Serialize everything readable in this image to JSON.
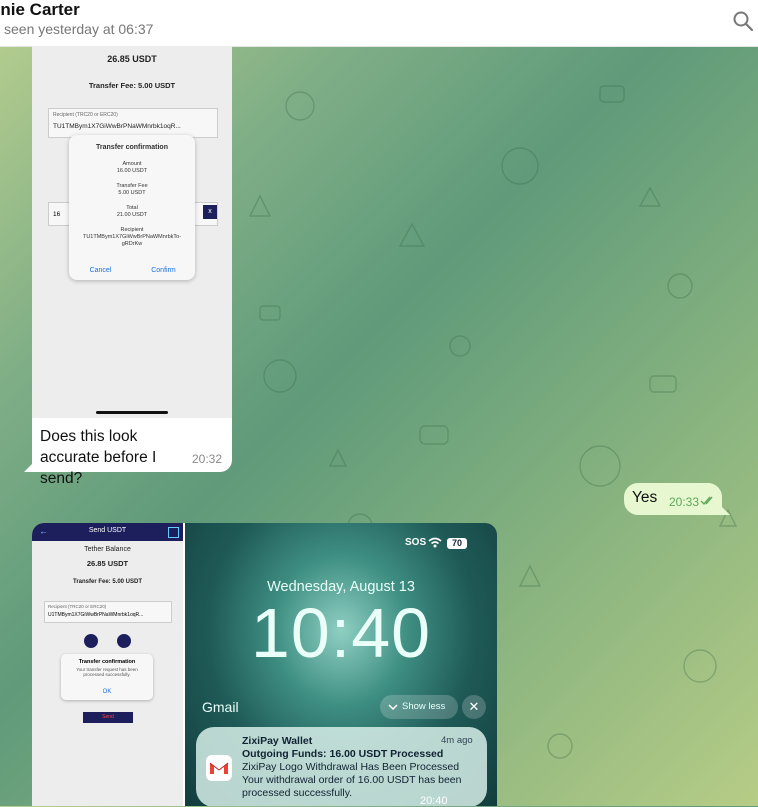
{
  "header": {
    "contact_name": "nnie Carter",
    "status": "seen yesterday at 06:37"
  },
  "message1": {
    "caption": "Does this look accurate before I send?",
    "time": "20:32",
    "screenshot": {
      "balance": "26.85 USDT",
      "transfer_fee": "Transfer Fee: 5.00 USDT",
      "recipient_label": "Recipient (TRC20 or ERC20)",
      "recipient_value": "TU1TMBym1X7GiWwBrPNaWMnrbk1oqR...",
      "amount_value": "16",
      "dialog": {
        "title": "Transfer confirmation",
        "amount_label": "Amount",
        "amount_value": "16.00 USDT",
        "fee_label": "Transfer Fee",
        "fee_value": "5.00 USDT",
        "total_label": "Total",
        "total_value": "21.00 USDT",
        "recipient_label": "Recipient",
        "recipient_value": "TU1TMBym1X7GiWwBrPNaWMnrbkTo-gRDrKw",
        "cancel": "Cancel",
        "confirm": "Confirm"
      }
    }
  },
  "message2": {
    "text": "Yes",
    "time": "20:33"
  },
  "message3": {
    "time": "20:40",
    "wallet_screenshot": {
      "title": "Send USDT",
      "balance_label": "Tether Balance",
      "balance": "26.85 USDT",
      "transfer_fee": "Transfer Fee: 5.00 USDT",
      "recipient_label": "Recipient (TRC20 or ERC20)",
      "recipient_value": "U1TMBym1X7GiWwBrPNaWMnrbk1oqR...",
      "dialog_title": "Transfer confirmation",
      "dialog_text": "Your transfer request has been processed successfully.",
      "dialog_ok": "OK",
      "send_button": "Send"
    },
    "lockscreen": {
      "status": "SOS",
      "battery": "70",
      "date": "Wednesday, August 13",
      "clock": "10:40",
      "app": "Gmail",
      "show_less": "Show less",
      "notification": {
        "sender": "ZixiPay Wallet",
        "age": "4m ago",
        "subject": "Outgoing Funds: 16.00 USDT Processed",
        "line1": "ZixiPay Logo Withdrawal Has Been Processed",
        "line2": "Your withdrawal order of 16.00 USDT has been",
        "line3": "processed successfully."
      }
    }
  }
}
